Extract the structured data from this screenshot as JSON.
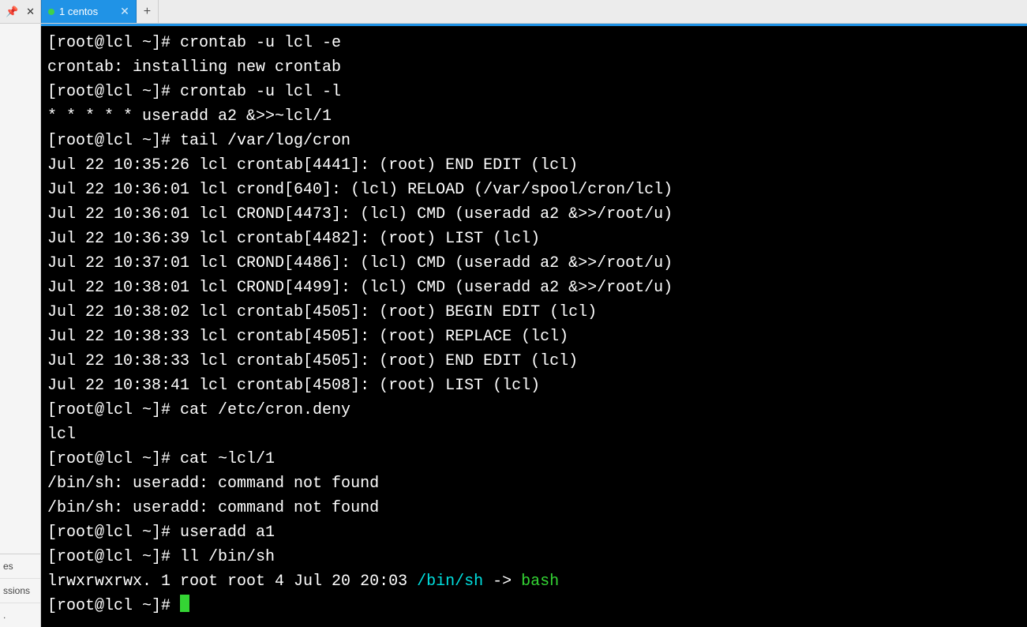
{
  "tabbar": {
    "pin_glyph": "📌",
    "close_glyph": "✕",
    "tab": {
      "label": "1 centos",
      "close_glyph": "✕"
    },
    "newtab_glyph": "+"
  },
  "sidebar": {
    "top_items": [],
    "bottom_items": [
      "es",
      "ssions",
      "."
    ]
  },
  "terminal": {
    "lines": [
      {
        "segments": [
          {
            "t": "[root@lcl ~]# crontab -u lcl -e"
          }
        ]
      },
      {
        "segments": [
          {
            "t": "crontab: installing new crontab"
          }
        ]
      },
      {
        "segments": [
          {
            "t": "[root@lcl ~]# crontab -u lcl -l"
          }
        ]
      },
      {
        "segments": [
          {
            "t": "* * * * * useradd a2 &>>~lcl/1"
          }
        ]
      },
      {
        "segments": [
          {
            "t": "[root@lcl ~]# tail /var/log/cron"
          }
        ]
      },
      {
        "segments": [
          {
            "t": "Jul 22 10:35:26 lcl crontab[4441]: (root) END EDIT (lcl)"
          }
        ]
      },
      {
        "segments": [
          {
            "t": "Jul 22 10:36:01 lcl crond[640]: (lcl) RELOAD (/var/spool/cron/lcl)"
          }
        ]
      },
      {
        "segments": [
          {
            "t": "Jul 22 10:36:01 lcl CROND[4473]: (lcl) CMD (useradd a2 &>>/root/u)"
          }
        ]
      },
      {
        "segments": [
          {
            "t": "Jul 22 10:36:39 lcl crontab[4482]: (root) LIST (lcl)"
          }
        ]
      },
      {
        "segments": [
          {
            "t": "Jul 22 10:37:01 lcl CROND[4486]: (lcl) CMD (useradd a2 &>>/root/u)"
          }
        ]
      },
      {
        "segments": [
          {
            "t": "Jul 22 10:38:01 lcl CROND[4499]: (lcl) CMD (useradd a2 &>>/root/u)"
          }
        ]
      },
      {
        "segments": [
          {
            "t": "Jul 22 10:38:02 lcl crontab[4505]: (root) BEGIN EDIT (lcl)"
          }
        ]
      },
      {
        "segments": [
          {
            "t": "Jul 22 10:38:33 lcl crontab[4505]: (root) REPLACE (lcl)"
          }
        ]
      },
      {
        "segments": [
          {
            "t": "Jul 22 10:38:33 lcl crontab[4505]: (root) END EDIT (lcl)"
          }
        ]
      },
      {
        "segments": [
          {
            "t": "Jul 22 10:38:41 lcl crontab[4508]: (root) LIST (lcl)"
          }
        ]
      },
      {
        "segments": [
          {
            "t": "[root@lcl ~]# cat /etc/cron.deny "
          }
        ]
      },
      {
        "segments": [
          {
            "t": "lcl"
          }
        ]
      },
      {
        "segments": [
          {
            "t": "[root@lcl ~]# cat ~lcl/1"
          }
        ]
      },
      {
        "segments": [
          {
            "t": "/bin/sh: useradd: command not found"
          }
        ]
      },
      {
        "segments": [
          {
            "t": "/bin/sh: useradd: command not found"
          }
        ]
      },
      {
        "segments": [
          {
            "t": "[root@lcl ~]# useradd a1"
          }
        ]
      },
      {
        "segments": [
          {
            "t": "[root@lcl ~]# ll /bin/sh"
          }
        ]
      },
      {
        "segments": [
          {
            "t": "lrwxrwxrwx. 1 root root 4 Jul 20 20:03 "
          },
          {
            "t": "/bin/sh",
            "cls": "cyan"
          },
          {
            "t": " -> "
          },
          {
            "t": "bash",
            "cls": "green"
          }
        ]
      },
      {
        "segments": [
          {
            "t": "[root@lcl ~]# "
          }
        ],
        "cursor": true
      }
    ]
  }
}
